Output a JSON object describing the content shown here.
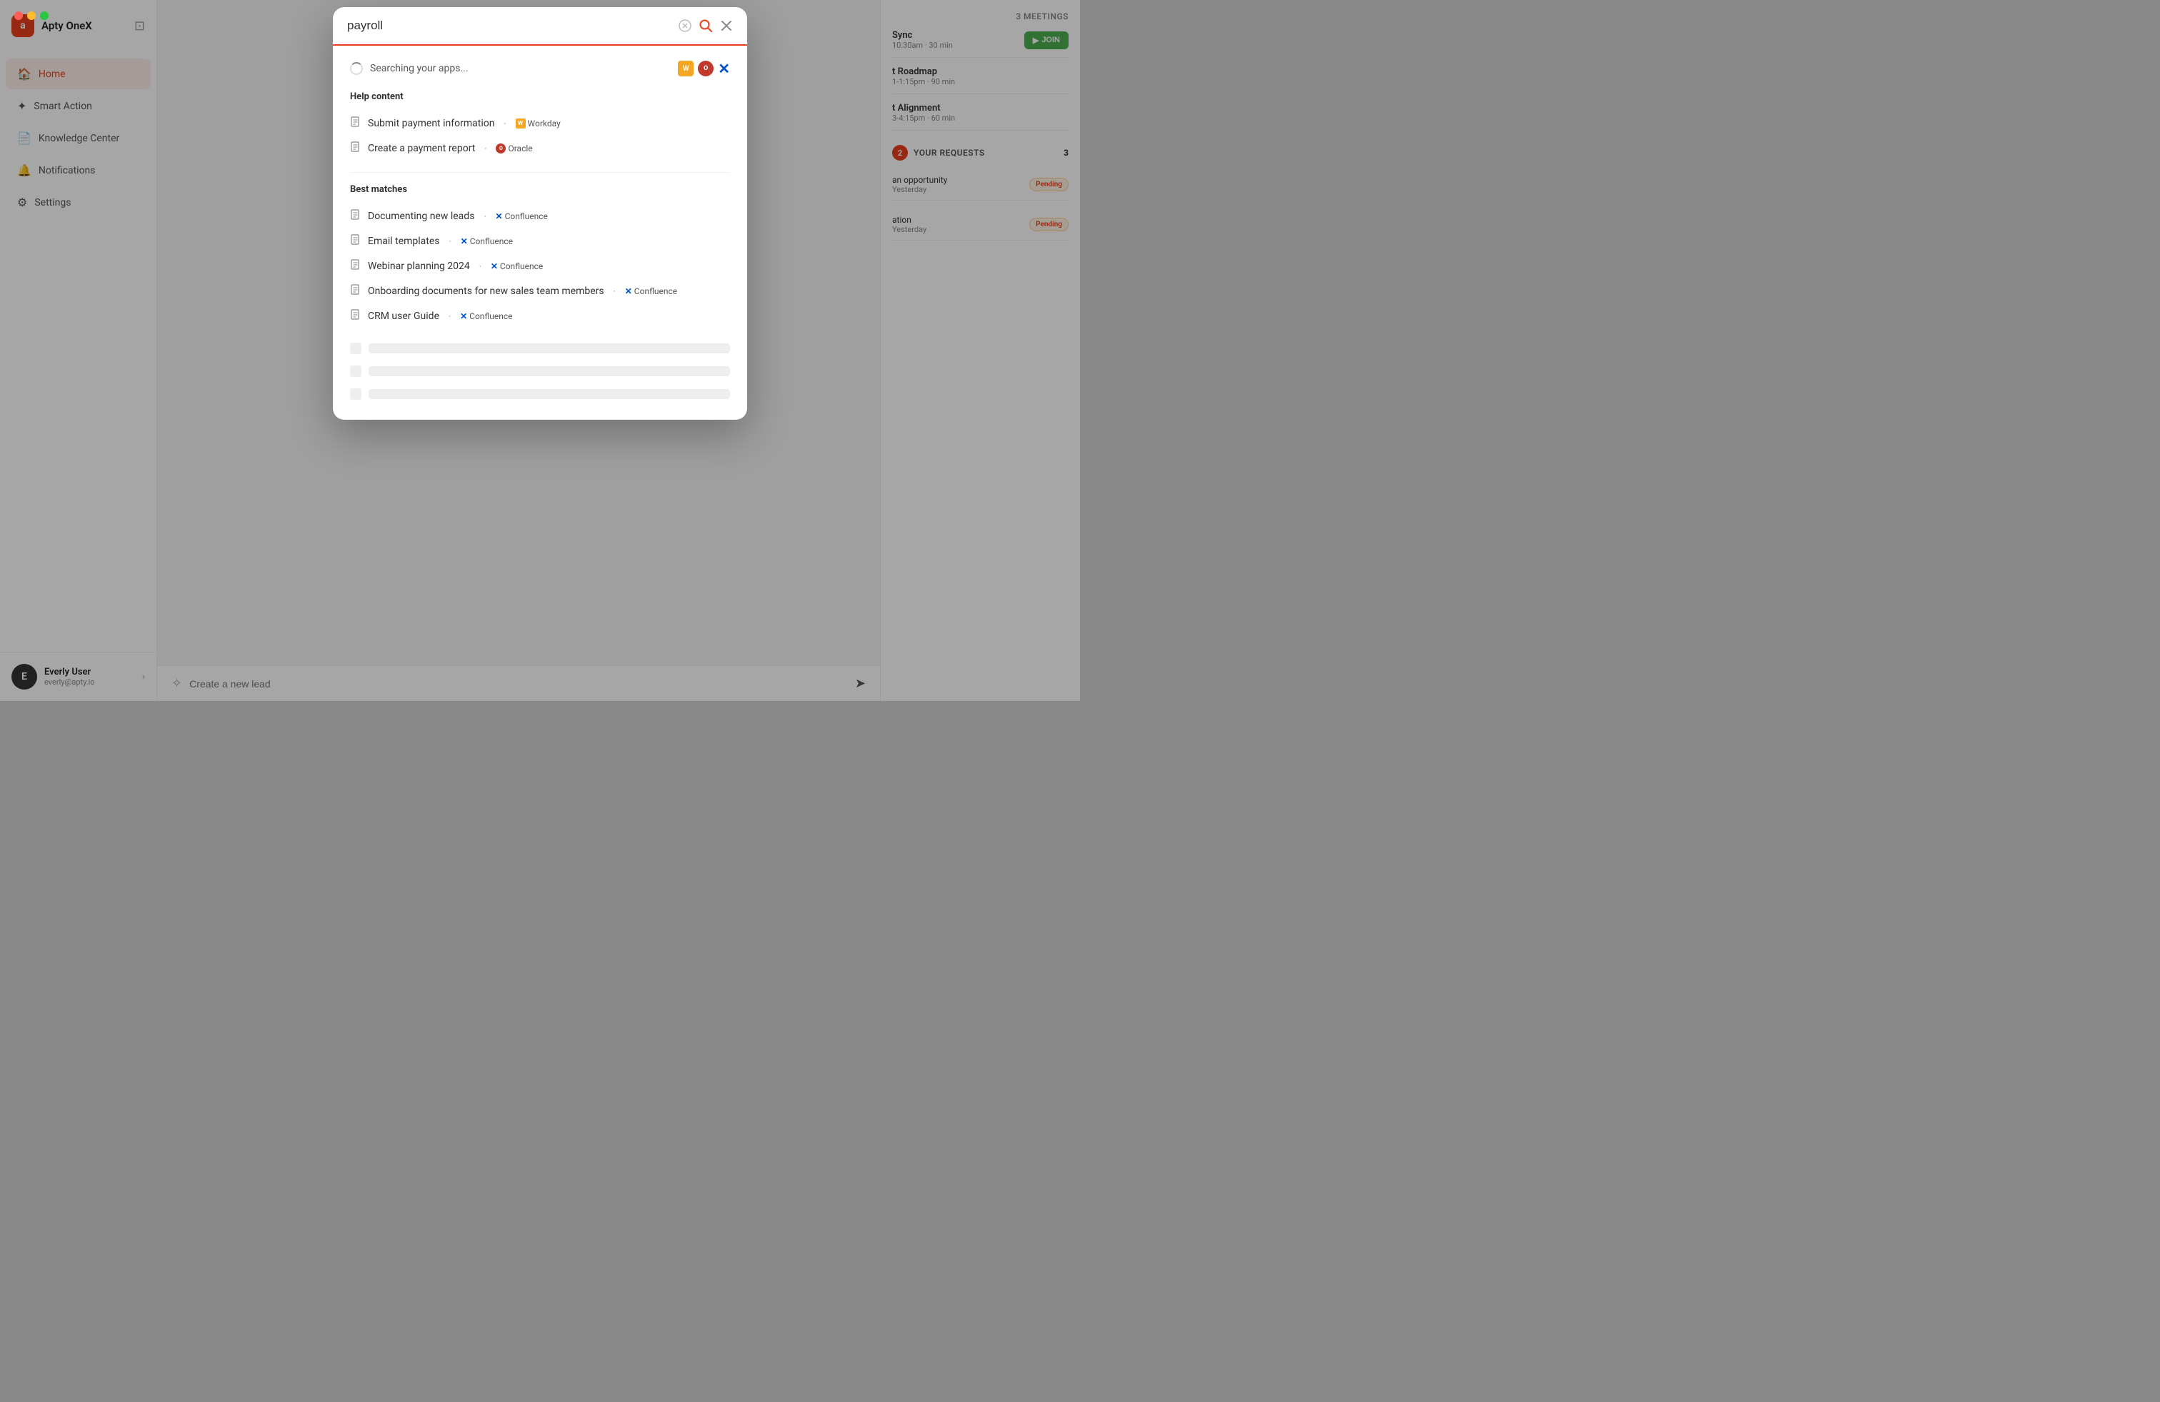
{
  "window": {
    "controls": [
      "close",
      "minimize",
      "maximize"
    ]
  },
  "sidebar": {
    "logo_letter": "a",
    "app_name": "Apty OneX",
    "nav_items": [
      {
        "id": "home",
        "label": "Home",
        "icon": "🏠",
        "active": true
      },
      {
        "id": "smart-action",
        "label": "Smart Action",
        "icon": "✦",
        "active": false
      },
      {
        "id": "knowledge-center",
        "label": "Knowledge Center",
        "icon": "□",
        "active": false
      },
      {
        "id": "notifications",
        "label": "Notifications",
        "icon": "🔔",
        "active": false
      },
      {
        "id": "settings",
        "label": "Settings",
        "icon": "⚙",
        "active": false
      }
    ],
    "user": {
      "avatar_letter": "E",
      "name": "Everly User",
      "email": "everly@apty.io"
    }
  },
  "right_panel": {
    "meetings_label": "3 MEETINGS",
    "meetings": [
      {
        "title": "Sync",
        "time": "10:30am · 30 min",
        "has_join": true
      },
      {
        "title": "t Roadmap",
        "time": "1-1:15pm · 90 min",
        "has_join": false
      },
      {
        "title": "t Alignment",
        "time": "3-4:15pm · 60 min",
        "has_join": false
      }
    ],
    "join_label": "JOIN",
    "requests_badge": "2",
    "requests_title": "YOUR REQUESTS",
    "requests_count": "3",
    "requests": [
      {
        "name": "an opportunity",
        "date": "Yesterday",
        "status": "Pending"
      },
      {
        "name": "ation",
        "date": "Yesterday",
        "status": "Pending"
      }
    ]
  },
  "modal": {
    "search_value": "payroll",
    "searching_text": "Searching your apps...",
    "app_icons": [
      {
        "id": "workday",
        "label": "W",
        "color": "#f5a623"
      },
      {
        "id": "oracle",
        "label": "O",
        "color": "#c0392b"
      },
      {
        "id": "confluence",
        "label": "✕",
        "color": "#0052CC"
      }
    ],
    "help_content_title": "Help content",
    "help_items": [
      {
        "text": "Submit payment information",
        "source": "Workday",
        "source_type": "workday"
      },
      {
        "text": "Create a payment report",
        "source": "Oracle",
        "source_type": "oracle"
      }
    ],
    "best_matches_title": "Best matches",
    "best_match_items": [
      {
        "text": "Documenting new leads",
        "source": "Confluence",
        "source_type": "confluence"
      },
      {
        "text": "Email templates",
        "source": "Confluence",
        "source_type": "confluence"
      },
      {
        "text": "Webinar planning 2024",
        "source": "Confluence",
        "source_type": "confluence"
      },
      {
        "text": "Onboarding documents for new sales team members",
        "source": "Confluence",
        "source_type": "confluence"
      },
      {
        "text": "CRM user Guide",
        "source": "Confluence",
        "source_type": "confluence"
      }
    ],
    "skeleton_rows": 3
  },
  "bottom_bar": {
    "placeholder": "Create a new lead"
  }
}
